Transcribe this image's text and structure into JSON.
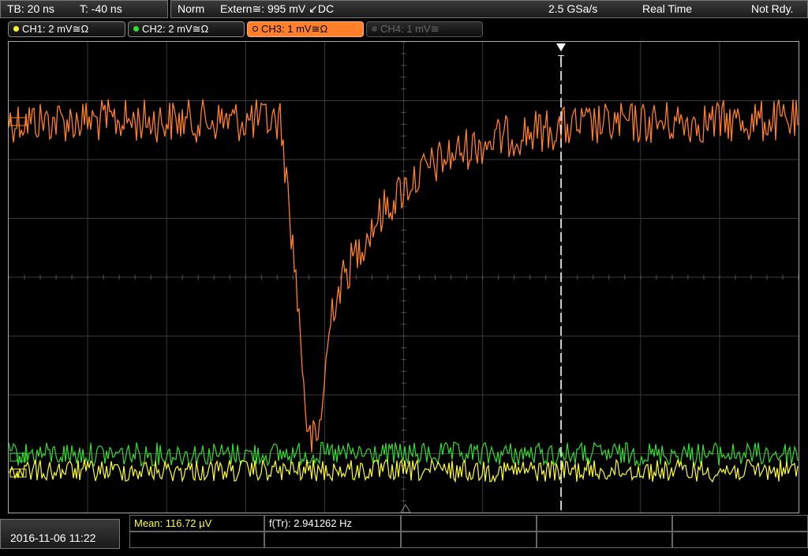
{
  "timebase": {
    "tb": "TB: 20 ns",
    "trigger_offset": "T: -40 ns"
  },
  "status": {
    "mode": "Norm",
    "trigger": "Extern≅: 995 mV ↙DC",
    "sample_rate": "2.5 GSa/s",
    "acq": "Real Time",
    "state": "Not Rdy."
  },
  "channels": [
    {
      "label": "CH1: 2 mV≅Ω",
      "color": "#ffff33"
    },
    {
      "label": "CH2: 2 mV≅Ω",
      "color": "#33dd33"
    },
    {
      "label": "CH3: 1 mV≅Ω",
      "color": "#ff7f2a"
    },
    {
      "label": "CH4: 1 mV≅",
      "color": "#666666"
    }
  ],
  "markers": {
    "ch3": "3",
    "ch2": "2",
    "ch1": "1",
    "trigger": "T"
  },
  "datetime": "2016-11-06 11:22",
  "measurements": {
    "mean": "Mean: 116.72 µV",
    "freq": "f(Tr): 2.941262 Hz"
  },
  "colors": {
    "grid": "#3a3a3a",
    "trigger_line": "#ffffff"
  }
}
